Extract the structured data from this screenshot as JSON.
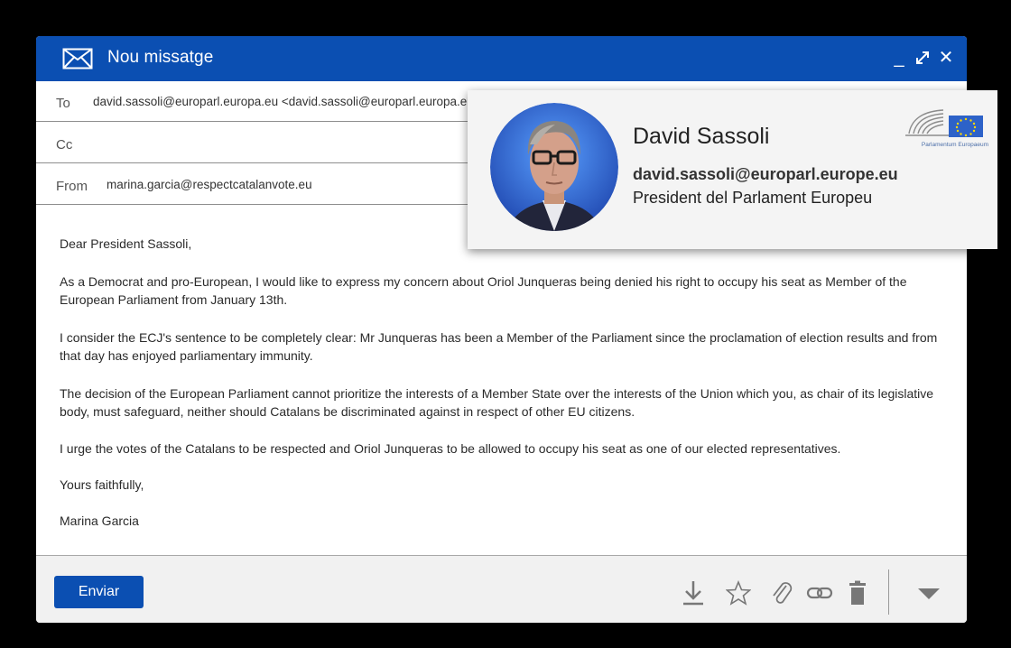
{
  "window": {
    "title": "Nou missatge",
    "icons": {
      "title": "envelope-icon",
      "minimize": "minimize-icon",
      "expand": "expand-icon",
      "close": "close-icon"
    },
    "minimize_glyph": "_",
    "close_glyph": "✕"
  },
  "fields": {
    "to": {
      "label": "To",
      "value": "david.sassoli@europarl.europa.eu <david.sassoli@europarl.europa.eu>"
    },
    "cc": {
      "label": "Cc",
      "value": ""
    },
    "from": {
      "label": "From",
      "value": "marina.garcia@respectcatalanvote.eu"
    }
  },
  "message": {
    "paragraphs": [
      "Dear President Sassoli,",
      "As a Democrat and pro-European, I would like to express my concern about Oriol Junqueras being denied his right to occupy his seat as Member of the European Parliament from January 13th.",
      "I consider the ECJ's sentence to be completely clear: Mr Junqueras has been a Member of the Parliament since the proclamation of election results and from that day has enjoyed parliamentary immunity.",
      "The decision of the European Parliament cannot prioritize the interests of a Member State over the interests of the Union which you, as chair of its legislative body, must safeguard, neither should Catalans be discriminated against in respect of other EU citizens.",
      "I urge the votes of the Catalans to be respected and Oriol Junqueras to be allowed to occupy his seat as one of our elected representatives.",
      "Yours faithfully,",
      "Marina Garcia"
    ]
  },
  "footer": {
    "send_label": "Enviar",
    "tools": [
      "download-icon",
      "star-icon",
      "paperclip-icon",
      "link-icon",
      "trash-icon",
      "chevron-down-icon"
    ]
  },
  "contact_card": {
    "name": "David Sassoli",
    "email": "david.sassoli@europarl.europe.eu",
    "role": "President del Parlament Europeu",
    "logo_text": "Parlamentum Europaeum"
  },
  "colors": {
    "accent": "#0b4fb2",
    "background": "#000000",
    "footer": "#f1f1f1",
    "card": "#f4f4f4",
    "eu_flag": "#2d62c8",
    "eu_star": "#ffd800"
  }
}
